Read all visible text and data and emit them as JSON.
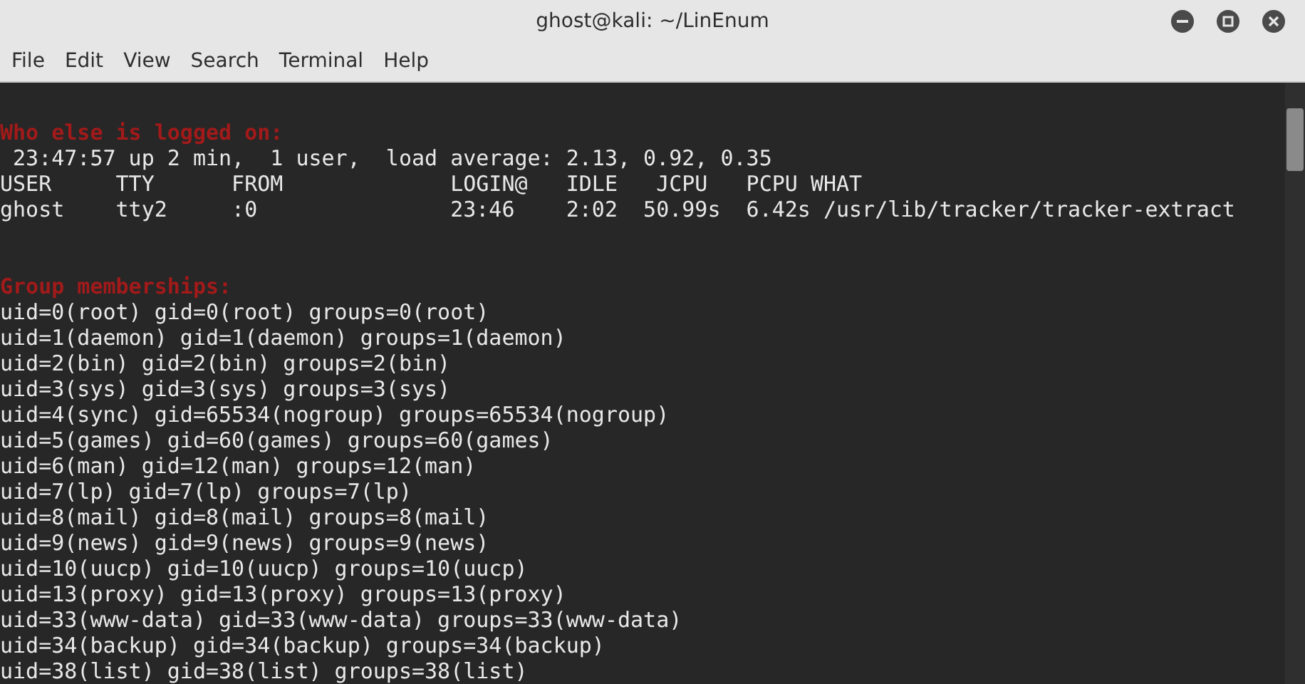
{
  "window": {
    "title": "ghost@kali: ~/LinEnum"
  },
  "menu": [
    "File",
    "Edit",
    "View",
    "Search",
    "Terminal",
    "Help"
  ],
  "terminal": {
    "sections": [
      {
        "heading": "Who else is logged on:",
        "lines": [
          " 23:47:57 up 2 min,  1 user,  load average: 2.13, 0.92, 0.35",
          "USER     TTY      FROM             LOGIN@   IDLE   JCPU   PCPU WHAT",
          "ghost    tty2     :0               23:46    2:02  50.99s  6.42s /usr/lib/tracker/tracker-extract"
        ]
      },
      {
        "heading": "Group memberships:",
        "lines": [
          "uid=0(root) gid=0(root) groups=0(root)",
          "uid=1(daemon) gid=1(daemon) groups=1(daemon)",
          "uid=2(bin) gid=2(bin) groups=2(bin)",
          "uid=3(sys) gid=3(sys) groups=3(sys)",
          "uid=4(sync) gid=65534(nogroup) groups=65534(nogroup)",
          "uid=5(games) gid=60(games) groups=60(games)",
          "uid=6(man) gid=12(man) groups=12(man)",
          "uid=7(lp) gid=7(lp) groups=7(lp)",
          "uid=8(mail) gid=8(mail) groups=8(mail)",
          "uid=9(news) gid=9(news) groups=9(news)",
          "uid=10(uucp) gid=10(uucp) groups=10(uucp)",
          "uid=13(proxy) gid=13(proxy) groups=13(proxy)",
          "uid=33(www-data) gid=33(www-data) groups=33(www-data)",
          "uid=34(backup) gid=34(backup) groups=34(backup)",
          "uid=38(list) gid=38(list) groups=38(list)"
        ]
      }
    ]
  }
}
